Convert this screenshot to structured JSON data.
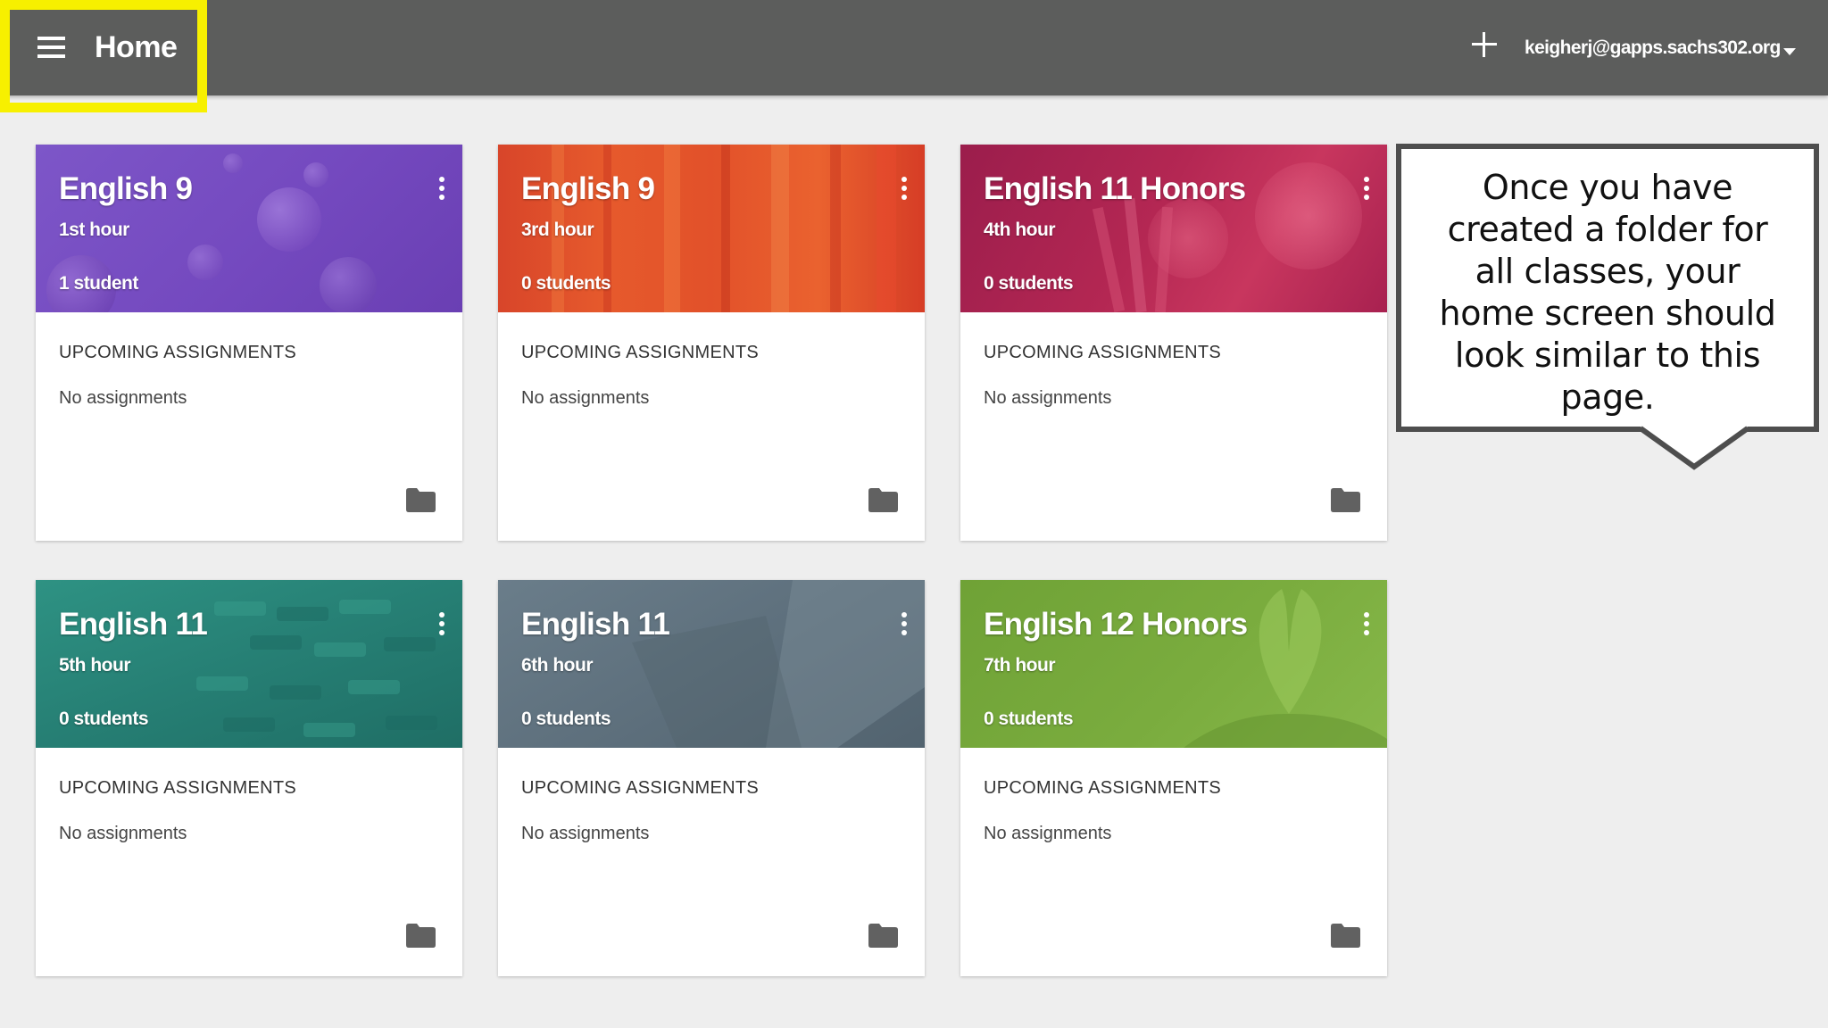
{
  "topbar": {
    "title": "Home",
    "account": "keigherj@gapps.sachs302.org",
    "menu_icon": "hamburger-menu-icon",
    "add_icon": "plus-icon",
    "caret_icon": "dropdown-arrow-icon"
  },
  "colors": {
    "topbar": "#5c5d5c",
    "highlight": "#f7f000",
    "background": "#eeeeee"
  },
  "classes": [
    {
      "name": "English 9",
      "section": "1st hour",
      "students": "1 student",
      "upcoming": "UPCOMING ASSIGNMENTS",
      "assignments": "No assignments",
      "theme": "purple-bubbles",
      "color": "#7b52c3"
    },
    {
      "name": "English 9",
      "section": "3rd hour",
      "students": "0 students",
      "upcoming": "UPCOMING ASSIGNMENTS",
      "assignments": "No assignments",
      "theme": "red-stripes",
      "color": "#e0502a"
    },
    {
      "name": "English 11 Honors",
      "section": "4th hour",
      "students": "0 students",
      "upcoming": "UPCOMING ASSIGNMENTS",
      "assignments": "No assignments",
      "theme": "magenta-pencils",
      "color": "#b0264f"
    },
    {
      "name": "English 11",
      "section": "5th hour",
      "students": "0 students",
      "upcoming": "UPCOMING ASSIGNMENTS",
      "assignments": "No assignments",
      "theme": "teal-cobblestones",
      "color": "#26857a"
    },
    {
      "name": "English 11",
      "section": "6th hour",
      "students": "0 students",
      "upcoming": "UPCOMING ASSIGNMENTS",
      "assignments": "No assignments",
      "theme": "slate-book",
      "color": "#5f7280"
    },
    {
      "name": "English 12 Honors",
      "section": "7th hour",
      "students": "0 students",
      "upcoming": "UPCOMING ASSIGNMENTS",
      "assignments": "No assignments",
      "theme": "green-book-heart",
      "color": "#76a83a"
    }
  ],
  "card_icons": {
    "more": "more-vert-icon",
    "folder": "folder-icon"
  },
  "callout": {
    "lines": [
      "Once you have",
      "created a folder for",
      "all classes, your",
      "home screen should",
      "look similar to this",
      "page."
    ]
  }
}
